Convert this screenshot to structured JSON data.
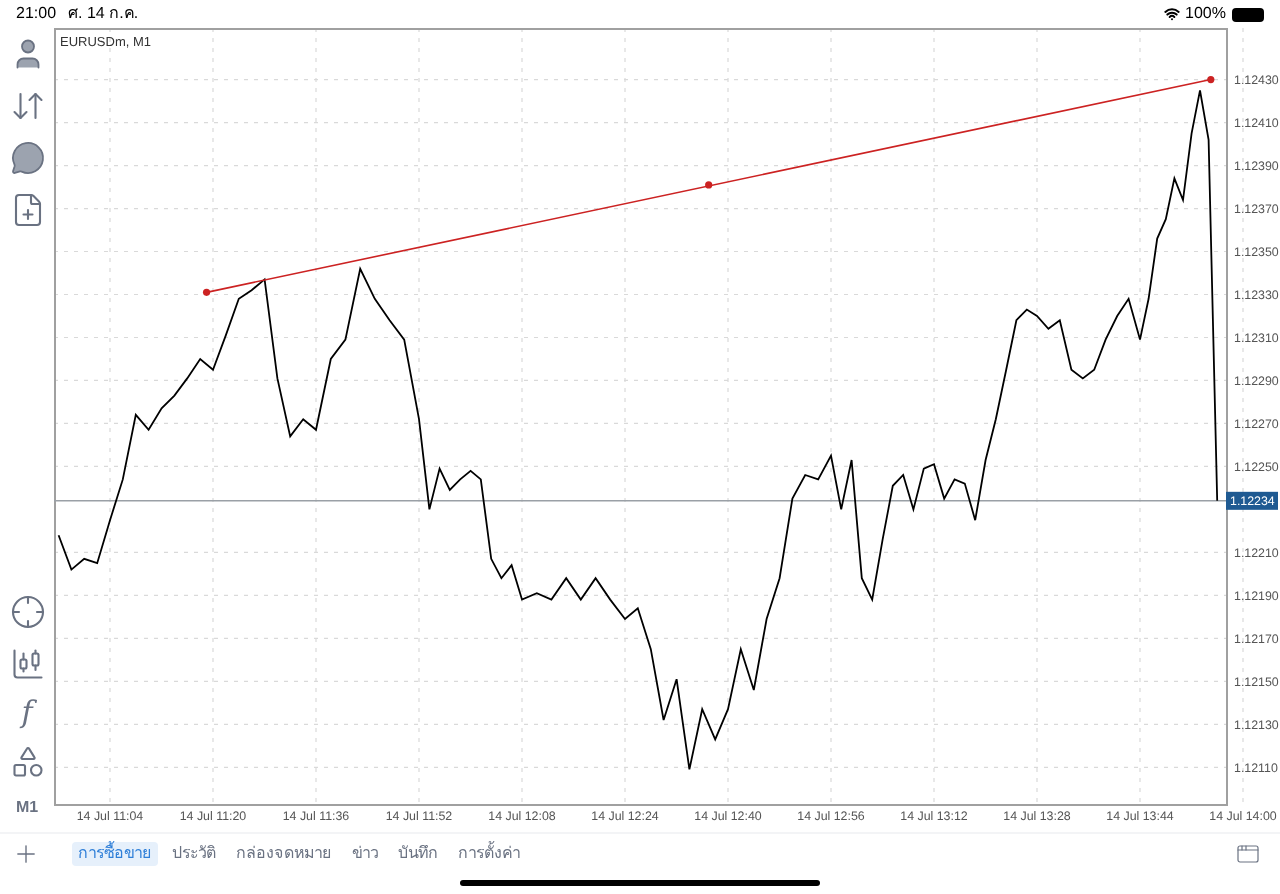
{
  "status_bar": {
    "time": "21:00",
    "date": "ศ. 14 ก.ค.",
    "battery": "100%"
  },
  "left_toolbar": {
    "indicator_symbol": "f",
    "timeframe": "M1"
  },
  "chart": {
    "chart_data": {
      "type": "line",
      "title": "EURUSDm, M1",
      "categories": [
        null,
        null,
        null,
        null,
        "14 Jul 11:04",
        null,
        null,
        null,
        null,
        null,
        null,
        null,
        "14 Jul 11:20",
        null,
        null,
        null,
        null,
        null,
        null,
        null,
        "14 Jul 11:36",
        null,
        null,
        null,
        null,
        null,
        null,
        "14 Jul 11:52",
        null,
        null,
        null,
        null,
        null,
        null,
        null,
        null,
        null,
        "14 Jul 12:08",
        null,
        null,
        null,
        null,
        null,
        null,
        "14 Jul 12:24",
        null,
        null,
        null,
        null,
        null,
        null,
        null,
        "14 Jul 12:40",
        null,
        null,
        null,
        null,
        null,
        null,
        null,
        "14 Jul 12:56",
        null,
        null,
        null,
        null,
        null,
        null,
        null,
        null,
        null,
        "14 Jul 13:12",
        null,
        null,
        null,
        null,
        null,
        null,
        null,
        null,
        null,
        "14 Jul 13:28",
        null,
        null,
        null,
        null,
        null,
        null,
        null,
        null,
        "14 Jul 13:44",
        null,
        null,
        null,
        null,
        null,
        null,
        null,
        null,
        null,
        null,
        null,
        "14 Jul 14:00"
      ],
      "series": [
        {
          "color": "#000000",
          "values": [
            1.12218,
            1.12202,
            1.12207,
            1.12205,
            1.12225,
            1.12244,
            1.12274,
            1.12267,
            1.12277,
            1.12283,
            1.12291,
            1.123,
            1.12295,
            1.12311,
            1.12328,
            1.12332,
            1.12337,
            1.12291,
            1.12264,
            1.12272,
            1.12267,
            1.123,
            1.12309,
            1.12342,
            1.12328,
            1.12318,
            1.12309,
            1.12272,
            1.1223,
            1.12249,
            1.12239,
            1.12244,
            1.12248,
            1.12244,
            1.12207,
            1.12198,
            1.12204,
            1.12188,
            1.12191,
            1.12188,
            1.12198,
            1.12188,
            1.12198,
            1.12188,
            1.12179,
            1.12184,
            1.12165,
            1.12132,
            1.12151,
            1.12109,
            1.12137,
            1.12123,
            1.12137,
            1.12165,
            1.12146,
            1.12179,
            1.12198,
            1.12235,
            1.12246,
            1.12244,
            1.12255,
            1.1223,
            1.12253,
            1.12198,
            1.12188,
            1.12216,
            1.12241,
            1.12246,
            1.1223,
            1.12249,
            1.12251,
            1.12235,
            1.12244,
            1.12242,
            1.12225,
            1.12253,
            1.12272,
            1.12295,
            1.12318,
            1.12323,
            1.1232,
            1.12314,
            1.12318,
            1.12295,
            1.12291,
            1.12295,
            1.12309,
            1.1232,
            1.12328,
            1.12309,
            1.12328,
            1.12356,
            1.12365,
            1.12384,
            1.12374,
            1.12405,
            1.12425,
            1.12402,
            1.12234,
            null,
            null,
            null
          ]
        }
      ],
      "ylim": [
        1.12092,
        1.12454
      ],
      "grid": true,
      "yticks": [
        {
          "value": 1.1243,
          "label": "1.12430"
        },
        {
          "value": 1.1241,
          "label": "1.12410"
        },
        {
          "value": 1.1239,
          "label": "1.12390"
        },
        {
          "value": 1.1237,
          "label": "1.12370"
        },
        {
          "value": 1.1235,
          "label": "1.12350"
        },
        {
          "value": 1.1233,
          "label": "1.12330"
        },
        {
          "value": 1.1231,
          "label": "1.12310"
        },
        {
          "value": 1.1229,
          "label": "1.12290"
        },
        {
          "value": 1.1227,
          "label": "1.12270"
        },
        {
          "value": 1.1225,
          "label": "1.12250"
        },
        {
          "value": 1.1221,
          "label": "1.12210"
        },
        {
          "value": 1.1219,
          "label": "1.12190"
        },
        {
          "value": 1.1217,
          "label": "1.12170"
        },
        {
          "value": 1.1215,
          "label": "1.12150"
        },
        {
          "value": 1.1213,
          "label": "1.12130"
        },
        {
          "value": 1.1211,
          "label": "1.12110"
        }
      ],
      "ref_lines": [
        {
          "axis": "y",
          "value": 1.12234,
          "label": "1.12234"
        }
      ]
    }
  },
  "bottom_tabs": [
    {
      "label": "การซื้อขาย",
      "selected": true
    },
    {
      "label": "ประวัติ",
      "selected": false
    },
    {
      "label": "กล่องจดหมาย",
      "selected": false
    },
    {
      "label": "ข่าว",
      "selected": false
    },
    {
      "label": "บันทึก",
      "selected": false
    },
    {
      "label": "การตั้งค่า",
      "selected": false
    }
  ]
}
